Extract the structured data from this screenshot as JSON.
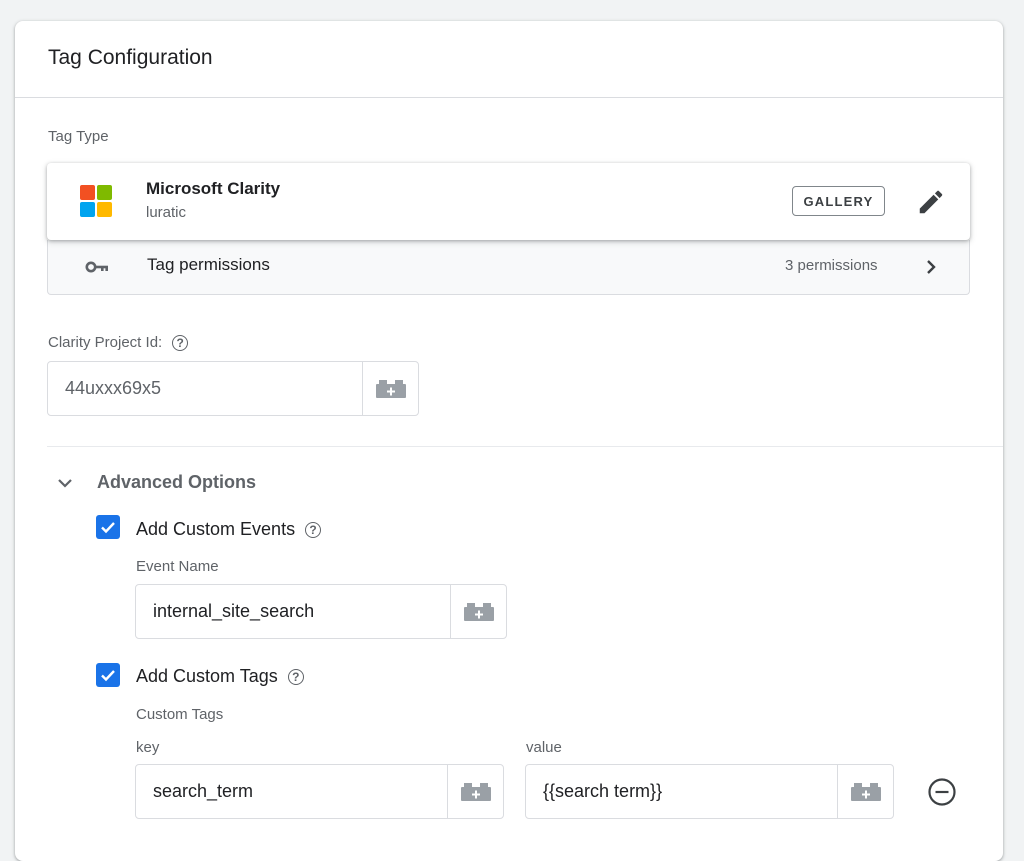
{
  "card": {
    "title": "Tag Configuration"
  },
  "tag_type": {
    "section_label": "Tag Type",
    "name": "Microsoft Clarity",
    "subtitle": "luratic",
    "gallery_label": "GALLERY",
    "logo_colors": [
      "#f25022",
      "#7fba00",
      "#00a4ef",
      "#ffb900"
    ],
    "edit_icon": "pencil-icon"
  },
  "permissions": {
    "label": "Tag permissions",
    "count": "3 permissions",
    "icon": "key-icon"
  },
  "project_id": {
    "label": "Clarity Project Id:",
    "value": "44uxxx69x5"
  },
  "advanced": {
    "label": "Advanced Options",
    "custom_events": {
      "checkbox_label": "Add Custom Events",
      "checked": true,
      "field_label": "Event Name",
      "value": "internal_site_search"
    },
    "custom_tags": {
      "checkbox_label": "Add Custom Tags",
      "checked": true,
      "section_label": "Custom Tags",
      "key_label": "key",
      "value_label": "value",
      "rows": [
        {
          "key": "search_term",
          "value": "{{search term}}"
        }
      ]
    }
  },
  "colors": {
    "accent": "#1a73e8",
    "text": "#202124",
    "muted": "#5f6368",
    "border": "#dadce0"
  }
}
